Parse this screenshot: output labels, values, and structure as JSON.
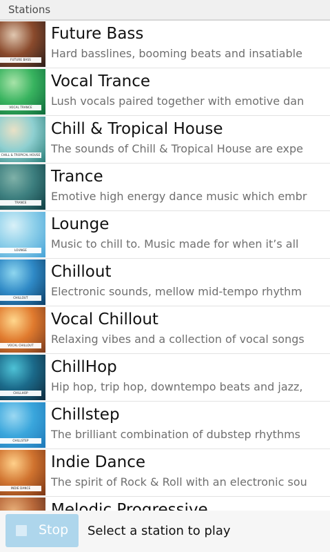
{
  "header": {
    "title": "Stations"
  },
  "stations": [
    {
      "name": "Future Bass",
      "description": "Hard basslines, booming beats and insatiable",
      "thumb_label": "FUTURE BASS",
      "thumb_colors": [
        "#2a1d1a",
        "#8a4a2c",
        "#e0c7b0"
      ]
    },
    {
      "name": "Vocal Trance",
      "description": "Lush vocals paired together with emotive dan",
      "thumb_label": "VOCAL TRANCE",
      "thumb_colors": [
        "#0f6a3b",
        "#38b35f",
        "#a7e3a8"
      ]
    },
    {
      "name": "Chill & Tropical House",
      "description": "The sounds of Chill & Tropical House are expe",
      "thumb_label": "CHILL & TROPICAL HOUSE",
      "thumb_colors": [
        "#2c7f7a",
        "#8ecfd0",
        "#e9e1c6"
      ]
    },
    {
      "name": "Trance",
      "description": "Emotive high energy dance music which embr",
      "thumb_label": "TRANCE",
      "thumb_colors": [
        "#0f3e43",
        "#3d7f7f",
        "#7fb1a8"
      ]
    },
    {
      "name": "Lounge",
      "description": "Music to chill to. Music made for when it’s all",
      "thumb_label": "LOUNGE",
      "thumb_colors": [
        "#47a3d7",
        "#8fd0ea",
        "#d9f1f8"
      ]
    },
    {
      "name": "Chillout",
      "description": "Electronic sounds, mellow mid-tempo rhythm",
      "thumb_label": "CHILLOUT",
      "thumb_colors": [
        "#0d3e66",
        "#2f89c6",
        "#8ed6ef"
      ]
    },
    {
      "name": "Vocal Chillout",
      "description": "Relaxing vibes and a collection of vocal songs",
      "thumb_label": "VOCAL CHILLOUT",
      "thumb_colors": [
        "#7a3b1e",
        "#e07a2e",
        "#ffd78d"
      ]
    },
    {
      "name": "ChillHop",
      "description": "Hip hop, trip hop, downtempo beats and jazz,",
      "thumb_label": "CHILLHOP",
      "thumb_colors": [
        "#0f2a3d",
        "#1b6a8a",
        "#4ec2d6"
      ]
    },
    {
      "name": "Chillstep",
      "description": "The brilliant combination of dubstep rhythms",
      "thumb_label": "CHILLSTEP",
      "thumb_colors": [
        "#1f78b8",
        "#3aa6dc",
        "#9bd8f2"
      ]
    },
    {
      "name": "Indie Dance",
      "description": "The spirit of Rock & Roll with an electronic sou",
      "thumb_label": "INDIE DANCE",
      "thumb_colors": [
        "#7a3515",
        "#d0732f",
        "#ffd08a"
      ]
    },
    {
      "name": "Melodic Progressive",
      "description": "",
      "thumb_label": "",
      "thumb_colors": [
        "#5a2a1a",
        "#b8683a",
        "#e8b07a"
      ]
    }
  ],
  "bottom_bar": {
    "stop_label": "Stop",
    "status": "Select a station to play"
  },
  "icons": {
    "stop": "stop-square-icon"
  },
  "colors": {
    "stop_button": "#aed6ec",
    "header_bg": "#f0f0f0",
    "description_text": "#6f6f6f"
  }
}
